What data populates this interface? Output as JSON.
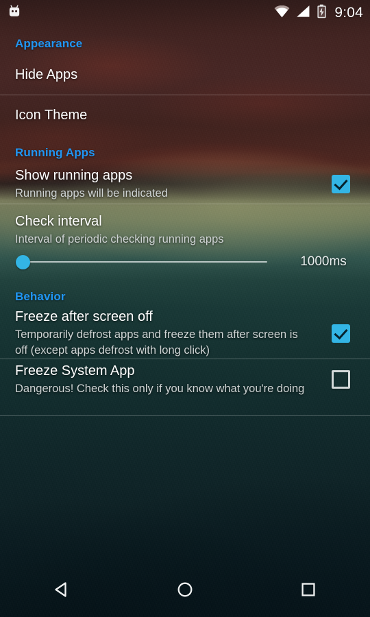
{
  "status_bar": {
    "notification_icon": "android-head-icon",
    "wifi_icon": "wifi-icon",
    "signal_icon": "cellular-signal-icon",
    "battery_icon": "battery-charging-icon",
    "clock": "9:04"
  },
  "accent_color": "#2196f3",
  "checkbox_checked_color": "#33b5e5",
  "sections": [
    {
      "header": "Appearance",
      "items": [
        {
          "title": "Hide Apps",
          "summary": "",
          "widget": "none"
        },
        {
          "title": "Icon Theme",
          "summary": "",
          "widget": "none"
        }
      ]
    },
    {
      "header": "Running Apps",
      "items": [
        {
          "title": "Show running apps",
          "summary": "Running apps will be indicated",
          "widget": "checkbox",
          "checked": true
        },
        {
          "title": "Check interval",
          "summary": "Interval of periodic checking running apps",
          "widget": "seekbar",
          "value_label": "1000ms",
          "slider_percent": 0
        }
      ]
    },
    {
      "header": "Behavior",
      "items": [
        {
          "title": "Freeze after screen off",
          "summary": "Temporarily defrost apps and freeze them after screen is off (except apps defrost with long click)",
          "widget": "checkbox",
          "checked": true
        },
        {
          "title": "Freeze System App",
          "summary": "Dangerous! Check this only if you know what you're doing",
          "widget": "checkbox",
          "checked": false
        }
      ]
    }
  ],
  "nav_bar": {
    "back": "back-button",
    "home": "home-button",
    "recents": "recents-button"
  }
}
